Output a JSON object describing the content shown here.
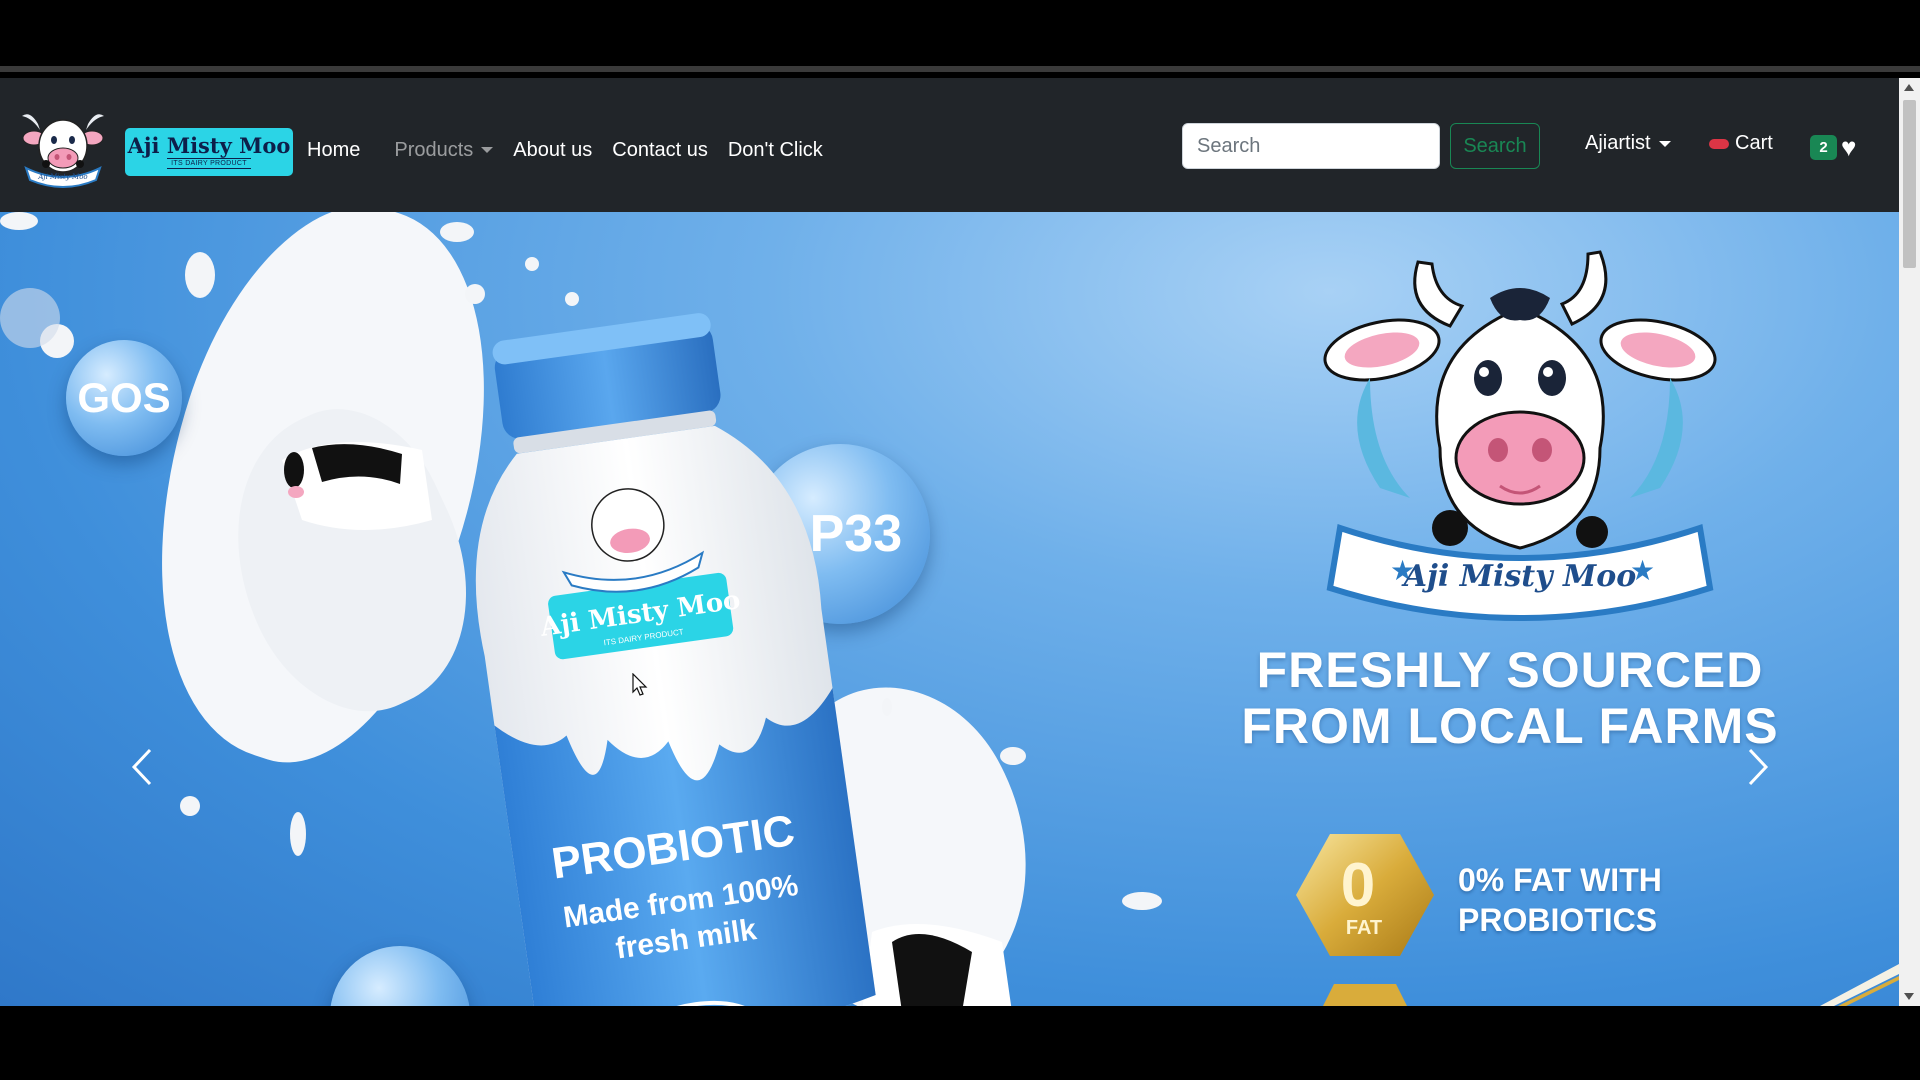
{
  "brand": {
    "name": "Aji Misty Moo",
    "tagline": "ITS DAIRY PRODUCT",
    "logo_arc_text": "Aji Misty Moo"
  },
  "nav": {
    "home": "Home",
    "products": "Products",
    "about": "About us",
    "contact": "Contact us",
    "dont_click": "Don't Click"
  },
  "search": {
    "placeholder": "Search",
    "value": "",
    "button_label": "Search"
  },
  "user_menu": {
    "label": "Ajiartist"
  },
  "cart": {
    "label": "Cart"
  },
  "wishlist": {
    "count": "2"
  },
  "hero": {
    "bubbles": [
      "GOS",
      "LP33"
    ],
    "bottle_label_brand": "Aji Misty Moo",
    "bottle_label_tag": "ITS DAIRY PRODUCT",
    "bottle_text_line1": "PROBIOTIC",
    "bottle_text_line2": "Made from 100%",
    "bottle_text_line3": "fresh milk",
    "mascot_banner": "Aji Misty Moo",
    "headline_line1": "FRESHLY SOURCED",
    "headline_line2": "FROM LOCAL FARMS",
    "fat_badge_big": "0",
    "fat_badge_small": "FAT",
    "fat_text_line1": "0% FAT WITH",
    "fat_text_line2": "PROBIOTICS"
  },
  "colors": {
    "navbar_bg": "#212529",
    "brand_badge": "#2bd4e6",
    "success": "#198754",
    "cart_pill": "#dc3545",
    "hero_blue": "#3f8fdb"
  },
  "icons": {
    "prev": "chevron-left-icon",
    "next": "chevron-right-icon",
    "heart": "heart-icon",
    "cart_pill": "cart-pill-icon"
  }
}
